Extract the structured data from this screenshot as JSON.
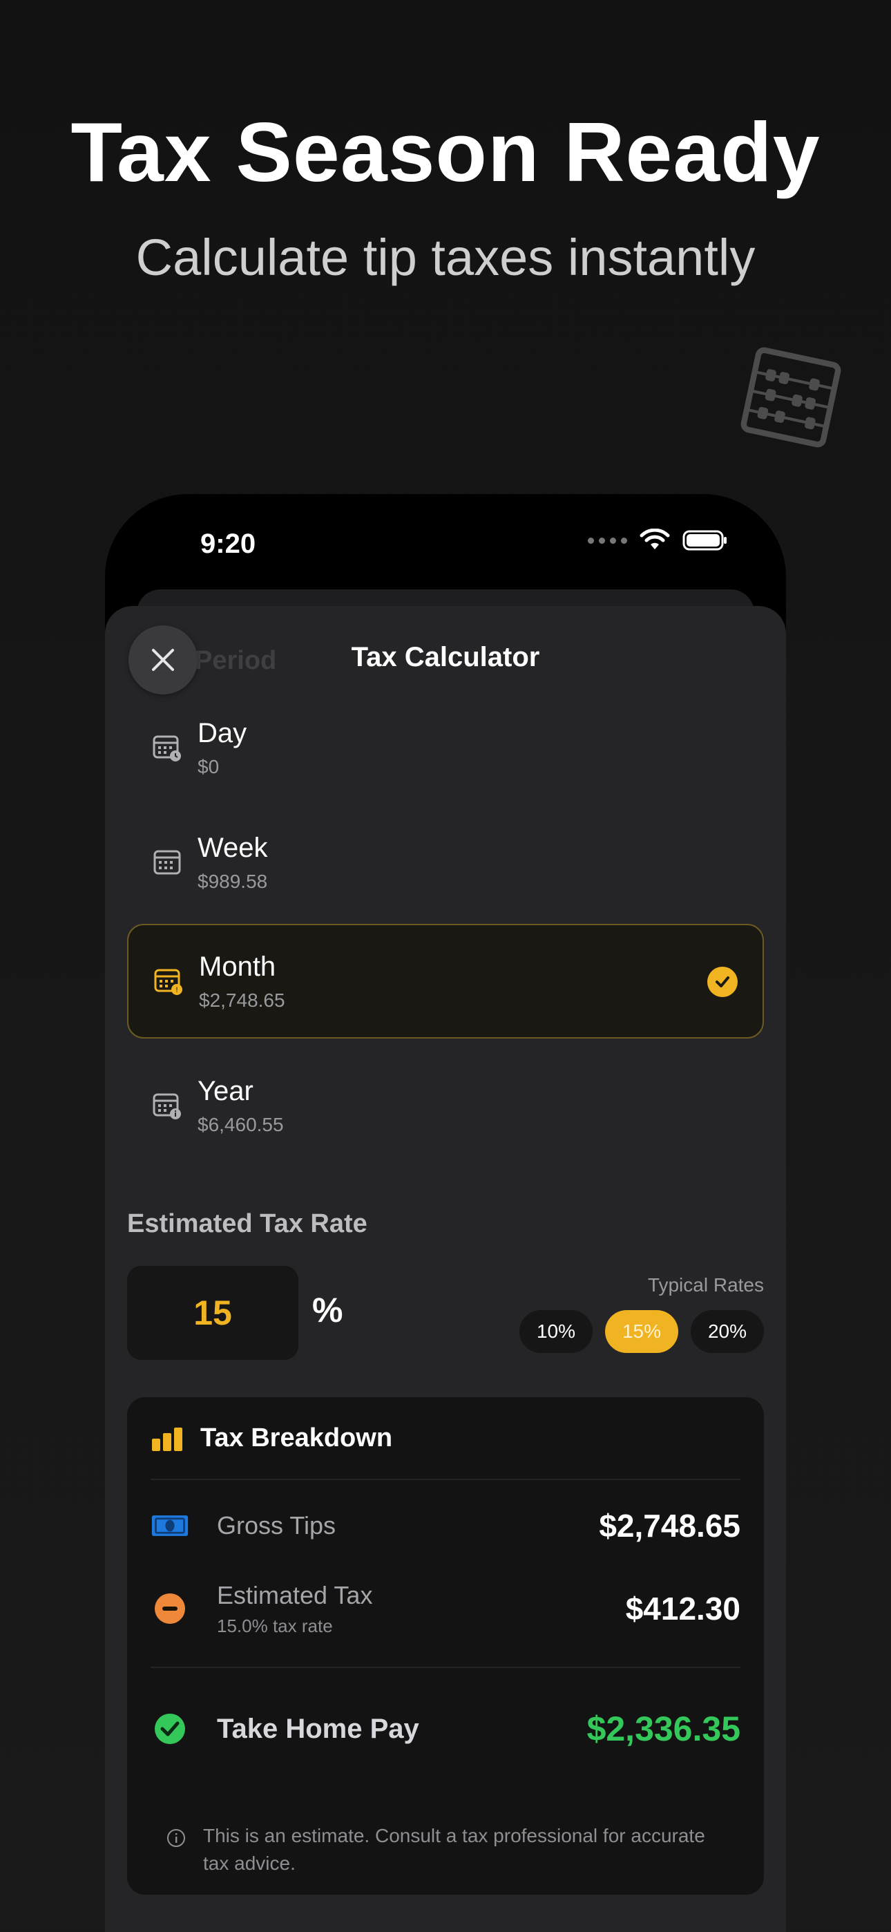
{
  "hero": {
    "title": "Tax Season Ready",
    "subtitle": "Calculate tip taxes instantly"
  },
  "status_bar": {
    "time": "9:20"
  },
  "sheet": {
    "ghost_label": "Period",
    "title": "Tax Calculator",
    "periods": [
      {
        "name": "Day",
        "amount": "$0",
        "selected": false
      },
      {
        "name": "Week",
        "amount": "$989.58",
        "selected": false
      },
      {
        "name": "Month",
        "amount": "$2,748.65",
        "selected": true
      },
      {
        "name": "Year",
        "amount": "$6,460.55",
        "selected": false
      }
    ],
    "tax_rate": {
      "label": "Estimated Tax Rate",
      "value": "15",
      "unit": "%",
      "typical_label": "Typical Rates",
      "options": [
        "10%",
        "15%",
        "20%"
      ],
      "active_option": "15%"
    },
    "breakdown": {
      "title": "Tax Breakdown",
      "gross_label": "Gross Tips",
      "gross_value": "$2,748.65",
      "tax_label": "Estimated Tax",
      "tax_sub": "15.0% tax rate",
      "tax_value": "$412.30",
      "home_label": "Take Home Pay",
      "home_value": "$2,336.35",
      "disclaimer": "This is an estimate. Consult a tax professional for accurate tax advice."
    }
  },
  "colors": {
    "accent": "#f0b321",
    "positive": "#34c759",
    "negative": "#f0883a",
    "money_icon": "#1f7ae0"
  },
  "icons": {
    "decor": "abacus-icon",
    "close": "close-icon",
    "period": "calendar-icon",
    "selected": "checkmark-circle-icon",
    "breakdown": "bar-chart-icon",
    "gross": "banknote-icon",
    "tax": "minus-circle-icon",
    "home": "checkmark-circle-icon",
    "info": "info-icon"
  }
}
